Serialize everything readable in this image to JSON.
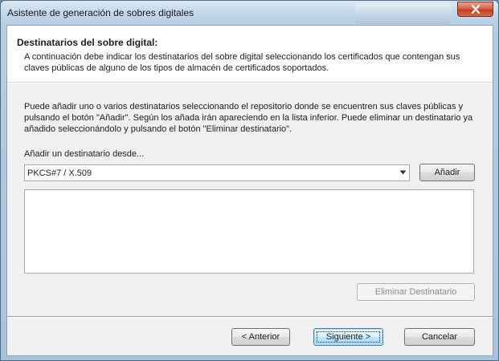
{
  "window": {
    "title": "Asistente de generación de sobres digitales"
  },
  "header": {
    "title": "Destinatarios del sobre digital:",
    "description": "A continuación debe indicar los destinatarios del sobre digital seleccionando los certificados que contengan sus claves públicas de alguno de los tipos de almacén de certificados soportados."
  },
  "main": {
    "instructions": "Puede añadir uno o varios destinatarios seleccionando el repositorio donde se encuentren sus claves públicas y pulsando el botón \"Añadir\". Según los añada irán apareciendo en la lista inferior. Puede eliminar un destinatario ya añadido seleccionándolo y pulsando el botón \"Eliminar destinatario\".",
    "add_from_label": "Añadir un destinatario desde...",
    "repository_select": {
      "selected": "PKCS#7 / X.509"
    },
    "add_button": "Añadir",
    "recipients": [],
    "remove_button": "Eliminar Destinatario"
  },
  "footer": {
    "back_button": "< Anterior",
    "next_button": "Siguiente >",
    "cancel_button": "Cancelar"
  },
  "icons": {
    "close": "close-icon",
    "dropdown": "chevron-down-icon"
  },
  "colors": {
    "close_button": "#c4401f",
    "default_button_border": "#3c7fb1",
    "panel_background": "#f0f0f0",
    "header_background": "#ffffff"
  }
}
